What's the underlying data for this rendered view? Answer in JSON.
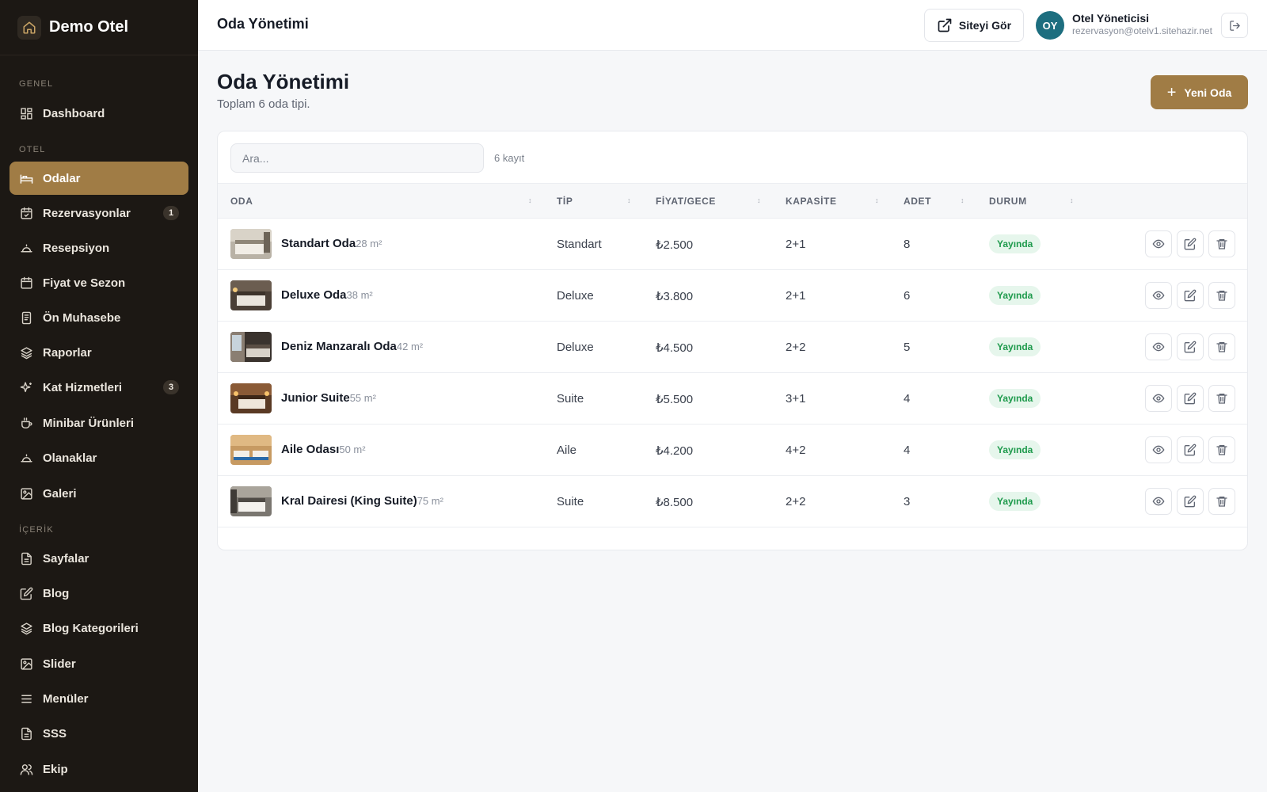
{
  "app": {
    "brand": "Demo Otel",
    "header_title": "Oda Yönetimi"
  },
  "sidebar": {
    "sections": [
      {
        "label": "GENEL"
      },
      {
        "label": "OTEL"
      },
      {
        "label": "İÇERİK"
      }
    ],
    "items": [
      {
        "label": "Dashboard",
        "icon": "dashboard-icon"
      },
      {
        "label": "Odalar",
        "icon": "bed-icon",
        "active": true
      },
      {
        "label": "Rezervasyonlar",
        "icon": "calendar-check-icon",
        "badge": "1"
      },
      {
        "label": "Resepsiyon",
        "icon": "bell-icon"
      },
      {
        "label": "Fiyat ve Sezon",
        "icon": "calendar-icon"
      },
      {
        "label": "Ön Muhasebe",
        "icon": "receipt-icon"
      },
      {
        "label": "Raporlar",
        "icon": "layers-icon"
      },
      {
        "label": "Kat Hizmetleri",
        "icon": "sparkles-icon",
        "badge": "3"
      },
      {
        "label": "Minibar Ürünleri",
        "icon": "coffee-icon"
      },
      {
        "label": "Olanaklar",
        "icon": "bell-icon"
      },
      {
        "label": "Galeri",
        "icon": "image-icon"
      },
      {
        "label": "Sayfalar",
        "icon": "file-icon"
      },
      {
        "label": "Blog",
        "icon": "edit-icon"
      },
      {
        "label": "Blog Kategorileri",
        "icon": "layers-icon"
      },
      {
        "label": "Slider",
        "icon": "image-icon"
      },
      {
        "label": "Menüler",
        "icon": "menu-icon"
      },
      {
        "label": "SSS",
        "icon": "file-icon"
      },
      {
        "label": "Ekip",
        "icon": "users-icon"
      }
    ]
  },
  "header": {
    "site_button": "Siteyi Gör",
    "avatar_initials": "OY",
    "user_name": "Otel Yöneticisi",
    "user_email": "rezervasyon@otelv1.sitehazir.net"
  },
  "page": {
    "title": "Oda Yönetimi",
    "subtitle": "Toplam 6 oda tipi.",
    "new_button": "Yeni Oda",
    "search_placeholder": "Ara...",
    "record_count": "6 kayıt"
  },
  "table": {
    "columns": [
      "ODA",
      "TİP",
      "FİYAT/GECE",
      "KAPASİTE",
      "ADET",
      "DURUM"
    ],
    "rows": [
      {
        "name": "Standart Oda",
        "size": "28 m²",
        "type": "Standart",
        "price": "₺2.500",
        "capacity": "2+1",
        "count": "8",
        "status": "Yayında"
      },
      {
        "name": "Deluxe Oda",
        "size": "38 m²",
        "type": "Deluxe",
        "price": "₺3.800",
        "capacity": "2+1",
        "count": "6",
        "status": "Yayında"
      },
      {
        "name": "Deniz Manzaralı Oda",
        "size": "42 m²",
        "type": "Deluxe",
        "price": "₺4.500",
        "capacity": "2+2",
        "count": "5",
        "status": "Yayında"
      },
      {
        "name": "Junior Suite",
        "size": "55 m²",
        "type": "Suite",
        "price": "₺5.500",
        "capacity": "3+1",
        "count": "4",
        "status": "Yayında"
      },
      {
        "name": "Aile Odası",
        "size": "50 m²",
        "type": "Aile",
        "price": "₺4.200",
        "capacity": "4+2",
        "count": "4",
        "status": "Yayında"
      },
      {
        "name": "Kral Dairesi (King Suite)",
        "size": "75 m²",
        "type": "Suite",
        "price": "₺8.500",
        "capacity": "2+2",
        "count": "3",
        "status": "Yayında"
      }
    ]
  },
  "colors": {
    "sidebar_bg": "#1c1814",
    "accent": "#a07c45",
    "status_green": "#1e9a4c",
    "avatar_bg": "#1d6e7f"
  }
}
